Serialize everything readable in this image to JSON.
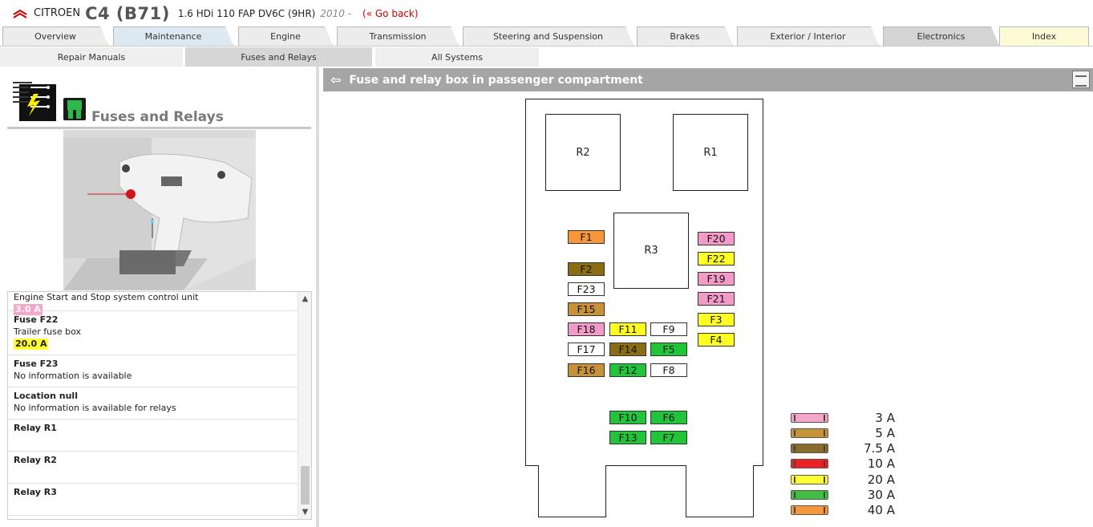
{
  "header": {
    "brand": "CITROEN",
    "model": "C4 (B71)",
    "engine": "1.6 HDi 110 FAP DV6C (9HR)",
    "year": "2010 -",
    "go_back": "(« Go back)"
  },
  "main_tabs": [
    "Overview",
    "Maintenance",
    "Engine",
    "Transmission",
    "Steering and Suspension",
    "Brakes",
    "Exterior / Interior",
    "Electronics",
    "Index"
  ],
  "sub_tabs": [
    "Repair Manuals",
    "Fuses and Relays",
    "All Systems"
  ],
  "left": {
    "title": "Fuses and Relays",
    "list": [
      {
        "desc": "Engine Start and Stop system control unit",
        "amp": "3.0 A",
        "color": "pink"
      },
      {
        "title": "Fuse F22",
        "desc": "Trailer fuse box",
        "amp": "20.0 A",
        "color": "yellow"
      },
      {
        "title": "Fuse F23",
        "desc": "No information is available"
      },
      {
        "title": "Location null",
        "desc": "No information is available for relays"
      },
      {
        "title": "Relay R1",
        "desc": ""
      },
      {
        "title": "Relay R2",
        "desc": ""
      },
      {
        "title": "Relay R3",
        "desc": ""
      }
    ]
  },
  "diagram": {
    "title": "Fuse and relay box in passenger compartment",
    "relays": [
      "R2",
      "R1",
      "R3"
    ],
    "fuses": [
      {
        "label": "F1",
        "color": "#f7963a"
      },
      {
        "label": "F2",
        "color": "#8a6d12"
      },
      {
        "label": "F23",
        "color": "#ffffff"
      },
      {
        "label": "F15",
        "color": "#c8923b"
      },
      {
        "label": "F18",
        "color": "#f49ac8"
      },
      {
        "label": "F17",
        "color": "#ffffff"
      },
      {
        "label": "F16",
        "color": "#c8923b"
      },
      {
        "label": "F11",
        "color": "#ffff22"
      },
      {
        "label": "F14",
        "color": "#8a6d12"
      },
      {
        "label": "F12",
        "color": "#22c43a"
      },
      {
        "label": "F9",
        "color": "#ffffff"
      },
      {
        "label": "F5",
        "color": "#22c43a"
      },
      {
        "label": "F8",
        "color": "#ffffff"
      },
      {
        "label": "F20",
        "color": "#f49ac8"
      },
      {
        "label": "F22",
        "color": "#ffff22"
      },
      {
        "label": "F19",
        "color": "#f49ac8"
      },
      {
        "label": "F21",
        "color": "#f49ac8"
      },
      {
        "label": "F3",
        "color": "#ffff22"
      },
      {
        "label": "F4",
        "color": "#ffff22"
      },
      {
        "label": "F10",
        "color": "#22c43a"
      },
      {
        "label": "F6",
        "color": "#22c43a"
      },
      {
        "label": "F13",
        "color": "#22c43a"
      },
      {
        "label": "F7",
        "color": "#22c43a"
      }
    ],
    "legend": [
      {
        "label": "3 A",
        "color": "#f4a7cb"
      },
      {
        "label": "5 A",
        "color": "#c8923b"
      },
      {
        "label": "7.5 A",
        "color": "#8a6d2a"
      },
      {
        "label": "10 A",
        "color": "#ee2222"
      },
      {
        "label": "20 A",
        "color": "#ffff33"
      },
      {
        "label": "30 A",
        "color": "#44bb44"
      },
      {
        "label": "40 A",
        "color": "#f7963a"
      }
    ]
  }
}
